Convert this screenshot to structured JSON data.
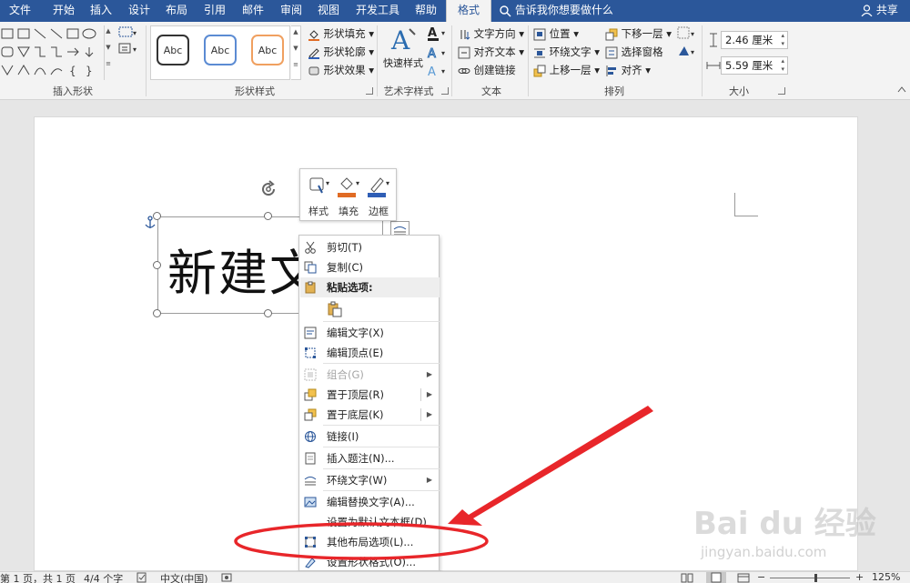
{
  "tabs": [
    {
      "id": "file",
      "label": "文件"
    },
    {
      "id": "home",
      "label": "开始"
    },
    {
      "id": "insert",
      "label": "插入"
    },
    {
      "id": "design",
      "label": "设计"
    },
    {
      "id": "layout",
      "label": "布局"
    },
    {
      "id": "references",
      "label": "引用"
    },
    {
      "id": "mailings",
      "label": "邮件"
    },
    {
      "id": "review",
      "label": "审阅"
    },
    {
      "id": "view",
      "label": "视图"
    },
    {
      "id": "developer",
      "label": "开发工具"
    },
    {
      "id": "help",
      "label": "帮助"
    },
    {
      "id": "format",
      "label": "格式",
      "active": true
    }
  ],
  "tellme": "告诉我你想要做什么",
  "share": "共享",
  "ribbon": {
    "groups": {
      "insert_shapes": "插入形状",
      "shape_styles": "形状样式",
      "wordart_styles": "艺术字样式",
      "text": "文本",
      "arrange": "排列",
      "size": "大小"
    },
    "style_sample": "Abc",
    "shape_fill": "形状填充",
    "shape_outline": "形状轮廓",
    "shape_effects": "形状效果",
    "quick_styles": "快速样式",
    "text_direction": "文字方向",
    "align_text": "对齐文本",
    "create_link": "创建链接",
    "position": "位置",
    "wrap_text": "环绕文字",
    "bring_forward": "上移一层",
    "send_backward": "下移一层",
    "selection_pane": "选择窗格",
    "align": "对齐",
    "height": "2.46 厘米",
    "width": "5.59 厘米"
  },
  "document": {
    "shape_text": "新建文"
  },
  "mini_toolbar": {
    "style": "样式",
    "fill": "填充",
    "border": "边框"
  },
  "context_menu": [
    {
      "label": "剪切(T)",
      "icon": "scissors-icon"
    },
    {
      "label": "复制(C)",
      "icon": "copy-icon"
    },
    {
      "label": "粘贴选项:",
      "icon": "paste-icon",
      "header": true
    },
    {
      "label": "",
      "icon": "paste-keep-icon",
      "paste": true
    },
    {
      "label": "编辑文字(X)",
      "icon": "edit-text-icon"
    },
    {
      "label": "编辑顶点(E)",
      "icon": "edit-points-icon"
    },
    {
      "label": "组合(G)",
      "icon": "group-icon",
      "disabled": true,
      "submenu": true
    },
    {
      "label": "置于顶层(R)",
      "icon": "bring-front-icon",
      "submenu": true
    },
    {
      "label": "置于底层(K)",
      "icon": "send-back-icon",
      "submenu": true
    },
    {
      "label": "链接(I)",
      "icon": "link-icon"
    },
    {
      "label": "插入题注(N)...",
      "icon": "caption-icon"
    },
    {
      "label": "环绕文字(W)",
      "icon": "wrap-icon",
      "submenu": true
    },
    {
      "label": "编辑替换文字(A)...",
      "icon": "alt-text-icon"
    },
    {
      "label": "设置为默认文本框(D)",
      "icon": "default-icon"
    },
    {
      "label": "其他布局选项(L)...",
      "icon": "layout-icon"
    },
    {
      "label": "设置形状格式(O)...",
      "icon": "format-shape-icon"
    }
  ],
  "status": {
    "page": "第 1 页，共 1 页",
    "words": "4/4 个字",
    "language": "中文(中国)",
    "zoom": "125%"
  },
  "watermark": {
    "brand": "Bai du 经验",
    "url": "jingyan.baidu.com"
  },
  "colors": {
    "accent": "#2b579a",
    "annotation_red": "#e8262a",
    "fill_orange": "#e06b24",
    "border_blue": "#2f5eb5"
  }
}
